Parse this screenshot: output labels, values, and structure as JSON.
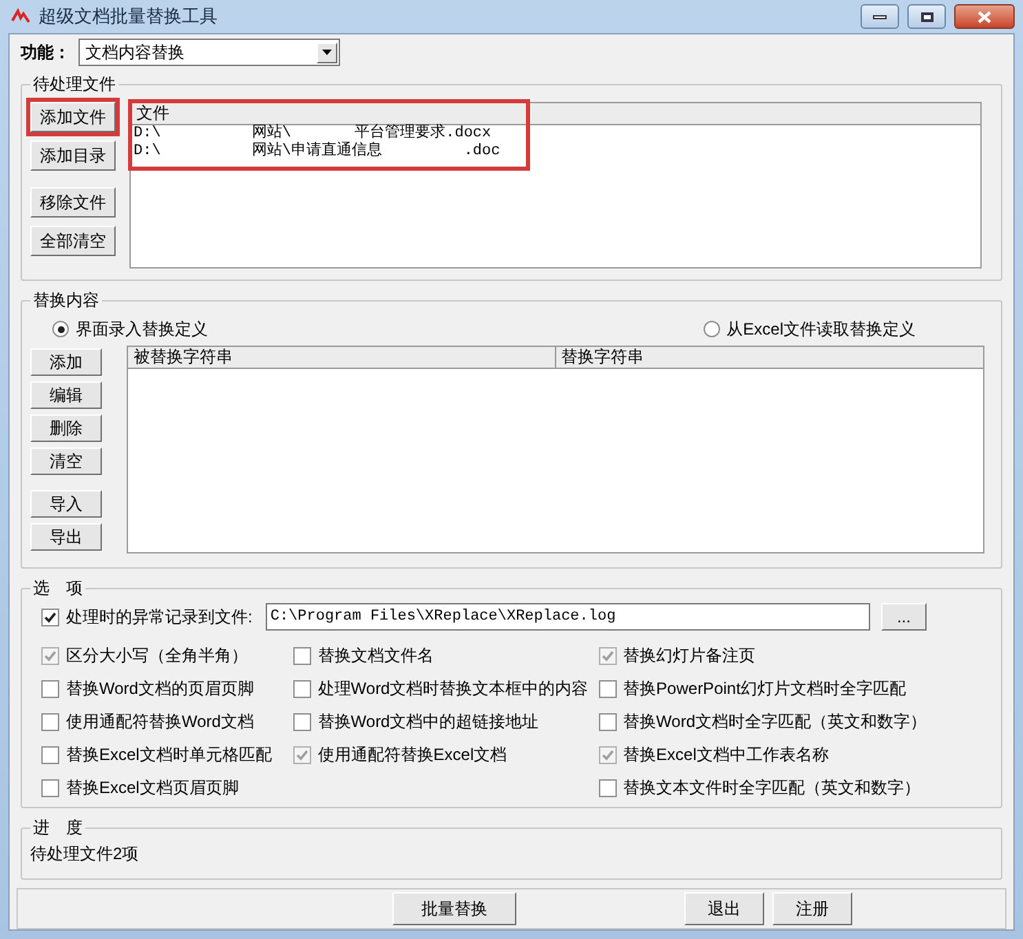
{
  "window": {
    "title": "超级文档批量替换工具"
  },
  "function": {
    "label": "功能：",
    "value": "文档内容替换"
  },
  "pending_files": {
    "title": "待处理文件",
    "buttons": [
      {
        "label": "添加文件",
        "highlighted": true
      },
      {
        "label": "添加目录",
        "highlighted": false
      },
      {
        "label": "移除文件",
        "highlighted": false
      },
      {
        "label": "全部清空",
        "highlighted": false
      }
    ],
    "list": {
      "highlighted": true,
      "columns": [
        "文件"
      ],
      "rows": [
        "D:\\          网站\\       平台管理要求.docx",
        "D:\\          网站\\申请直通信息         .doc"
      ]
    }
  },
  "replace": {
    "title": "替换内容",
    "radios": [
      {
        "label": "界面录入替换定义",
        "selected": true
      },
      {
        "label": "从Excel文件读取替换定义",
        "selected": false
      }
    ],
    "buttons": [
      "添加",
      "编辑",
      "删除",
      "清空",
      "导入",
      "导出"
    ],
    "columns": [
      "被替换字符串",
      "替换字符串"
    ]
  },
  "options": {
    "title": "选　项",
    "log": {
      "label": "处理时的异常记录到文件:",
      "checked": true,
      "value": "C:\\Program Files\\XReplace\\XReplace.log",
      "browse": "..."
    },
    "columns": [
      [
        {
          "label": "区分大小写（全角半角）",
          "checked": true,
          "disabled": true
        },
        {
          "label": "替换Word文档的页眉页脚",
          "checked": false,
          "disabled": false
        },
        {
          "label": "使用通配符替换Word文档",
          "checked": false,
          "disabled": false
        },
        {
          "label": "替换Excel文档时单元格匹配",
          "checked": false,
          "disabled": false
        },
        {
          "label": "替换Excel文档页眉页脚",
          "checked": false,
          "disabled": false
        }
      ],
      [
        {
          "label": "替换文档文件名",
          "checked": false,
          "disabled": false
        },
        {
          "label": "处理Word文档时替换文本框中的内容",
          "checked": false,
          "disabled": false
        },
        {
          "label": "替换Word文档中的超链接地址",
          "checked": false,
          "disabled": false
        },
        {
          "label": "使用通配符替换Excel文档",
          "checked": true,
          "disabled": true
        }
      ],
      [
        {
          "label": "替换幻灯片备注页",
          "checked": true,
          "disabled": true
        },
        {
          "label": "替换PowerPoint幻灯片文档时全字匹配",
          "checked": false,
          "disabled": false
        },
        {
          "label": "替换Word文档时全字匹配（英文和数字）",
          "checked": false,
          "disabled": false
        },
        {
          "label": "替换Excel文档中工作表名称",
          "checked": true,
          "disabled": true
        },
        {
          "label": "替换文本文件时全字匹配（英文和数字）",
          "checked": false,
          "disabled": false
        }
      ]
    ]
  },
  "progress": {
    "title": "进　度",
    "text": "待处理文件2项"
  },
  "buttons": [
    {
      "label": "批量替换"
    },
    {
      "label": "退出"
    },
    {
      "label": "注册"
    }
  ]
}
